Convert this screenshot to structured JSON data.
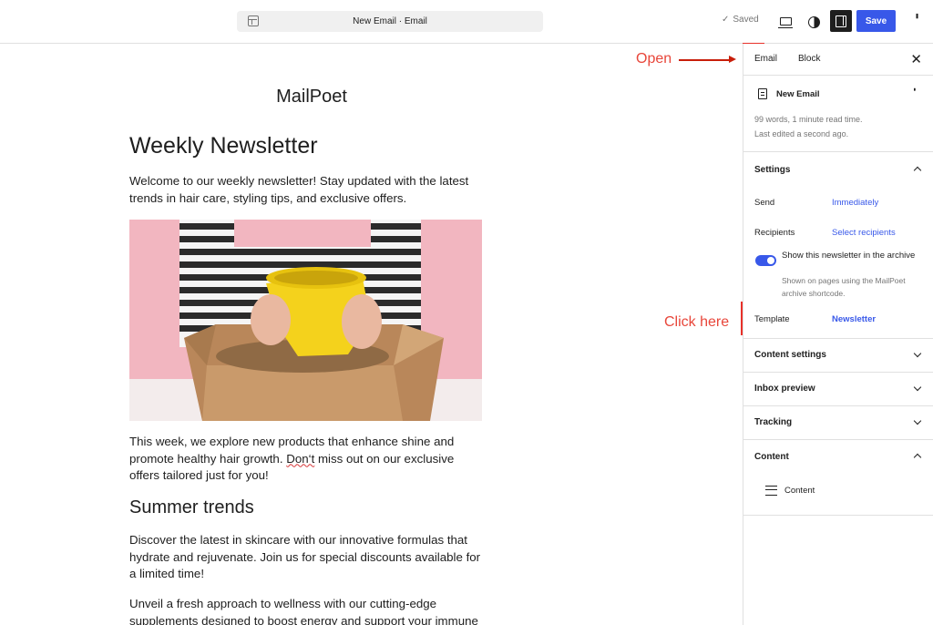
{
  "topbar": {
    "document_title": "New Email · Email",
    "saved_label": "Saved",
    "save_label": "Save",
    "accent_color": "#3858e9"
  },
  "icons": {
    "layout": "layout-icon",
    "check": "check-icon",
    "preview": "desktop-preview-icon",
    "styles": "contrast-icon",
    "settings": "sidebar-toggle-icon",
    "options": "more-vertical-icon",
    "close": "close-icon"
  },
  "email": {
    "brand": "MailPoet",
    "heading": "Weekly Newsletter",
    "intro": "Welcome to our weekly newsletter! Stay updated with the latest trends in hair care, styling tips, and exclusive offers.",
    "paragraph2_before": "This week, we explore new products that enhance shine and promote healthy hair growth. ",
    "paragraph2_misspelled": "Don‘t",
    "paragraph2_after": " miss out on our exclusive offers tailored just for you!",
    "subheading": "Summer trends",
    "paragraph3": "Discover the latest in skincare with our innovative formulas that hydrate and rejuvenate. Join us for special discounts available for a limited time!",
    "paragraph4": "Unveil a fresh approach to wellness with our cutting-edge supplements designed to boost energy and support your immune"
  },
  "annotations": {
    "open_label": "Open",
    "click_label": "Click here",
    "color": "#e8312a"
  },
  "sidebar": {
    "tabs": [
      "Email",
      "Block"
    ],
    "summary": {
      "title": "New Email",
      "stats": "99 words, 1 minute read time.",
      "edited": "Last edited a second ago."
    },
    "settings": {
      "title": "Settings",
      "send_label": "Send",
      "send_value": "Immediately",
      "recipients_label": "Recipients",
      "recipients_value": "Select recipients",
      "archive_toggle": "Show this newsletter in the archive",
      "archive_help": "Shown on pages using the MailPoet archive shortcode.",
      "template_label": "Template",
      "template_value": "Newsletter"
    },
    "panels": [
      "Content settings",
      "Inbox preview",
      "Tracking"
    ],
    "content": {
      "title": "Content",
      "item": "Content"
    }
  }
}
